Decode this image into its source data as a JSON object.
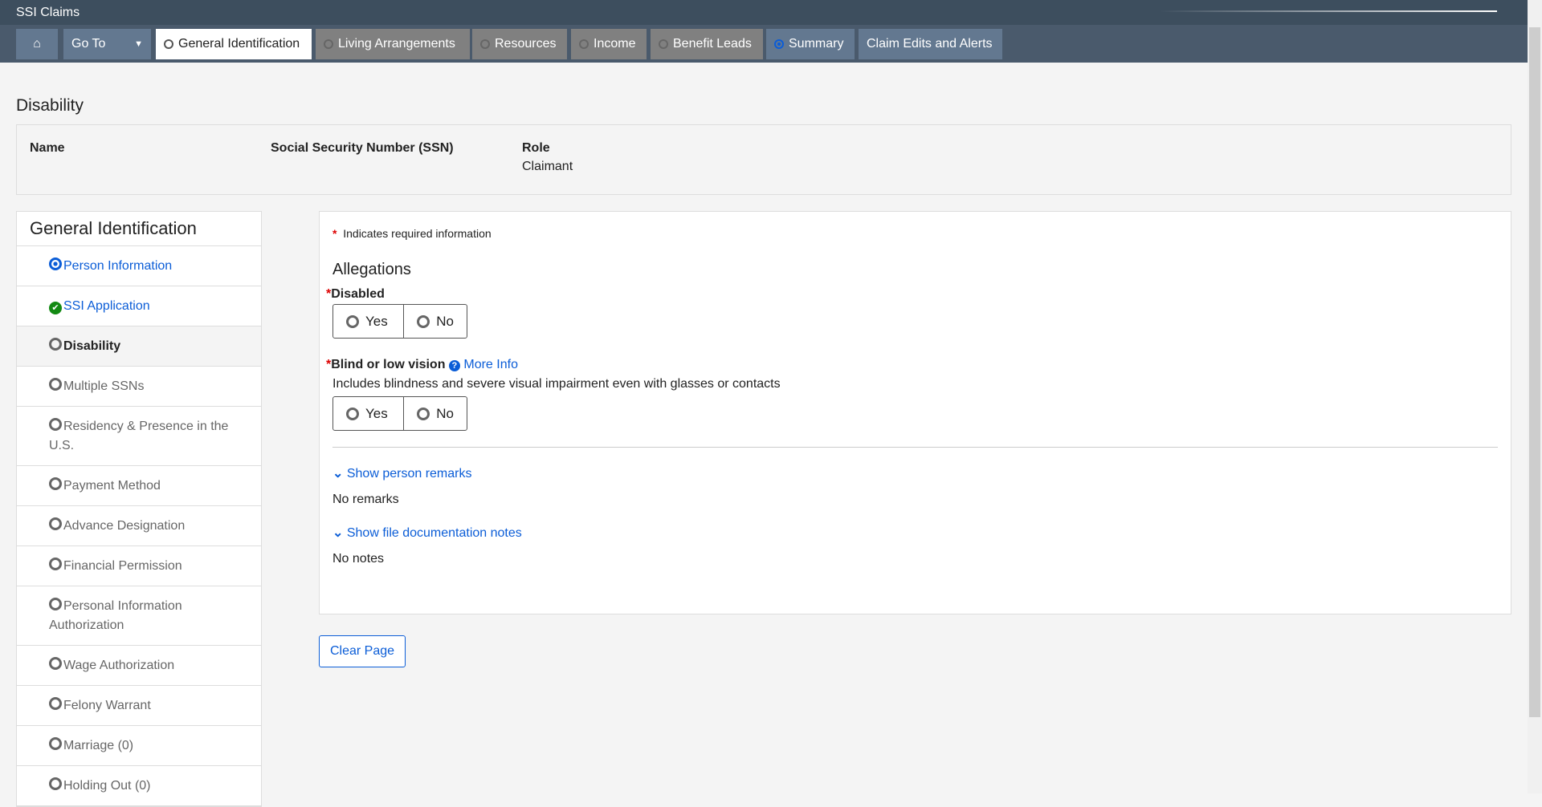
{
  "app": {
    "title": "SSI Claims"
  },
  "nav": {
    "home_icon": "home-icon",
    "goto": "Go To",
    "tabs": [
      {
        "label": "General Identification",
        "state": "current"
      },
      {
        "label": "Living Arrangements",
        "state": "disabled"
      },
      {
        "label": "Resources",
        "state": "disabled"
      },
      {
        "label": "Income",
        "state": "disabled"
      },
      {
        "label": "Benefit Leads",
        "state": "disabled"
      },
      {
        "label": "Summary",
        "state": "selected"
      },
      {
        "label": "Claim Edits and Alerts",
        "state": "plain"
      }
    ]
  },
  "page": {
    "title": "Disability"
  },
  "person": {
    "name_label": "Name",
    "ssn_label": "Social Security Number (SSN)",
    "role_label": "Role",
    "role_value": "Claimant"
  },
  "sidebar": {
    "title": "General Identification",
    "items": [
      {
        "label": "Person Information",
        "status": "selected"
      },
      {
        "label": "SSI Application",
        "status": "complete"
      },
      {
        "label": "Disability",
        "status": "current"
      },
      {
        "label": "Multiple SSNs"
      },
      {
        "label": "Residency & Presence in the U.S."
      },
      {
        "label": "Payment Method"
      },
      {
        "label": "Advance Designation"
      },
      {
        "label": "Financial Permission"
      },
      {
        "label": "Personal Information Authorization"
      },
      {
        "label": "Wage Authorization"
      },
      {
        "label": "Felony Warrant"
      },
      {
        "label": "Marriage (0)"
      },
      {
        "label": "Holding Out (0)"
      }
    ]
  },
  "form": {
    "required_note": "Indicates required information",
    "required_mark": "*",
    "section": "Allegations",
    "disabled": {
      "label": "Disabled",
      "yes": "Yes",
      "no": "No"
    },
    "blind": {
      "label": "Blind or low vision",
      "more_info": "More Info",
      "help": "Includes blindness and severe visual impairment even with glasses or contacts",
      "yes": "Yes",
      "no": "No"
    },
    "remarks": {
      "toggle": "Show person remarks",
      "value": "No remarks"
    },
    "notes": {
      "toggle": "Show file documentation notes",
      "value": "No notes"
    }
  },
  "actions": {
    "clear": "Clear Page"
  },
  "colors": {
    "link": "#0b5dd7",
    "header": "#3d4e5e",
    "nav": "#4a5a6c"
  }
}
